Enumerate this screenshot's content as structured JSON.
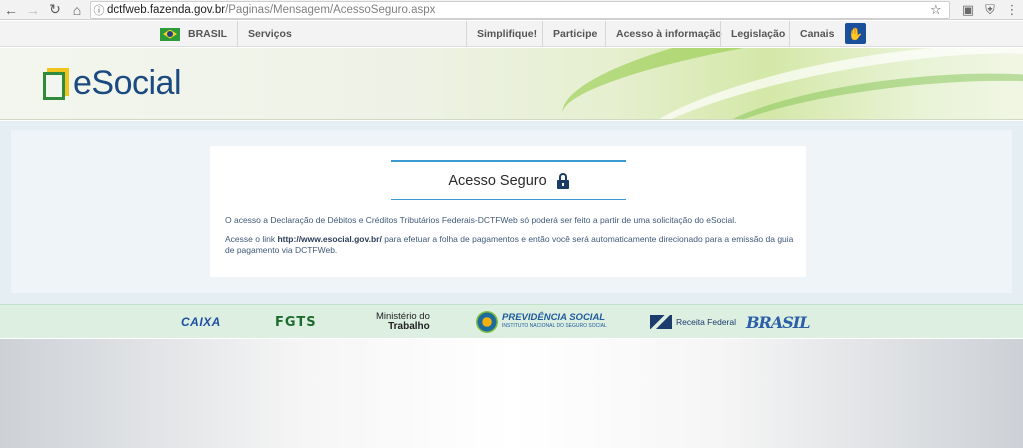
{
  "browser": {
    "url_host": "dctfweb.fazenda.gov.br",
    "url_path": "/Paginas/Mensagem/AcessoSeguro.aspx"
  },
  "govbar": {
    "brasil_label": "BRASIL",
    "servicos_label": "Serviços",
    "links": [
      "Simplifique!",
      "Participe",
      "Acesso à informação",
      "Legislação",
      "Canais"
    ]
  },
  "header": {
    "logo_text": "eSocial"
  },
  "main": {
    "title": "Acesso Seguro",
    "paragraph1": "O acesso a Declaração de Débitos e Créditos Tributários Federais-DCTFWeb só poderá ser feito a partir de uma solicitação do eSocial.",
    "paragraph2_prefix": "Acesse o link ",
    "paragraph2_link": "http://www.esocial.gov.br/",
    "paragraph2_suffix": " para efetuar a folha de pagamentos e então você será automaticamente direcionado para a emissão da guia de pagamento via DCTFWeb."
  },
  "partners": {
    "caixa": "CAIXA",
    "fgts": "FGTS",
    "ministerio_l1": "Ministério do",
    "ministerio_l2": "Trabalho",
    "previdencia_l1": "PREVIDÊNCIA SOCIAL",
    "previdencia_l2": "INSTITUTO NACIONAL DO SEGURO SOCIAL",
    "receita": "Receita Federal",
    "brasil": "BRASIL"
  },
  "colors": {
    "accent_blue": "#3a9ad1",
    "logo_blue": "#1b4a80",
    "logo_green": "#2f8b3b",
    "logo_yellow": "#f1c31f"
  }
}
